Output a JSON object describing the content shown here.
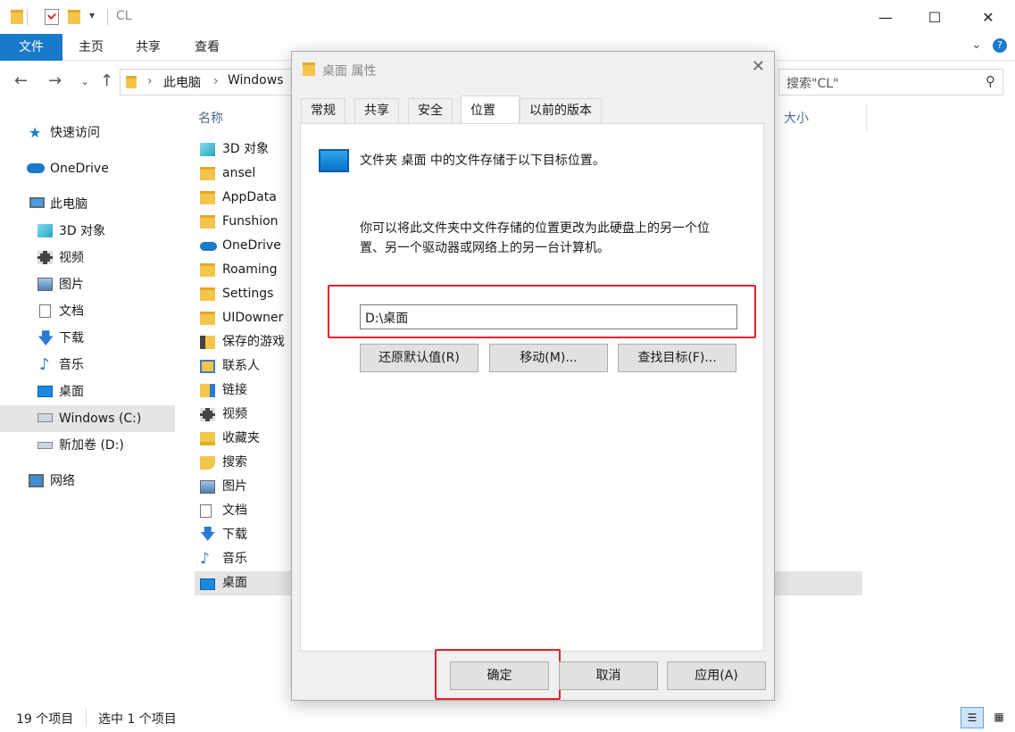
{
  "window": {
    "title": "CL",
    "ribbon_tabs": [
      "文件",
      "主页",
      "共享",
      "查看"
    ]
  },
  "address": {
    "crumbs": [
      "此电脑",
      "Windows"
    ],
    "search_placeholder": "搜索\"CL\""
  },
  "sidebar": {
    "items": [
      {
        "label": "快速访问",
        "icon": "star-icon"
      },
      {
        "label": "OneDrive",
        "icon": "cloud-icon"
      },
      {
        "label": "此电脑",
        "icon": "computer-icon"
      },
      {
        "label": "3D 对象",
        "icon": "cube-icon"
      },
      {
        "label": "视频",
        "icon": "video-icon"
      },
      {
        "label": "图片",
        "icon": "picture-icon"
      },
      {
        "label": "文档",
        "icon": "document-icon"
      },
      {
        "label": "下载",
        "icon": "download-icon"
      },
      {
        "label": "音乐",
        "icon": "music-icon"
      },
      {
        "label": "桌面",
        "icon": "desktop-icon"
      },
      {
        "label": "Windows (C:)",
        "icon": "drive-icon",
        "selected": true
      },
      {
        "label": "新加卷 (D:)",
        "icon": "drive-icon"
      },
      {
        "label": "网络",
        "icon": "network-icon"
      }
    ]
  },
  "filelist": {
    "col_name": "名称",
    "col_size": "大小",
    "rows": [
      {
        "label": "3D 对象",
        "icon": "cube-icon"
      },
      {
        "label": "ansel",
        "icon": "folder-icon"
      },
      {
        "label": "AppData",
        "icon": "folder-icon"
      },
      {
        "label": "Funshion",
        "icon": "folder-icon"
      },
      {
        "label": "OneDrive",
        "icon": "cloud-icon"
      },
      {
        "label": "Roaming",
        "icon": "folder-icon"
      },
      {
        "label": "Settings",
        "icon": "folder-icon"
      },
      {
        "label": "UIDowner",
        "icon": "folder-icon"
      },
      {
        "label": "保存的游戏",
        "icon": "game-icon"
      },
      {
        "label": "联系人",
        "icon": "contacts-icon"
      },
      {
        "label": "链接",
        "icon": "link-icon"
      },
      {
        "label": "视频",
        "icon": "video-icon"
      },
      {
        "label": "收藏夹",
        "icon": "favorites-icon"
      },
      {
        "label": "搜索",
        "icon": "search-folder-icon"
      },
      {
        "label": "图片",
        "icon": "picture-icon"
      },
      {
        "label": "文档",
        "icon": "document-icon"
      },
      {
        "label": "下载",
        "icon": "download-icon"
      },
      {
        "label": "音乐",
        "icon": "music-icon"
      },
      {
        "label": "桌面",
        "icon": "desktop-icon",
        "selected": true
      }
    ]
  },
  "status": {
    "count": "19 个项目",
    "selected": "选中 1 个项目"
  },
  "dialog": {
    "title": "桌面 属性",
    "tabs": [
      "常规",
      "共享",
      "安全",
      "位置",
      "以前的版本"
    ],
    "active_tab": "位置",
    "heading": "文件夹 桌面 中的文件存储于以下目标位置。",
    "description_line1": "你可以将此文件夹中文件存储的位置更改为此硬盘上的另一个位",
    "description_line2": "置、另一个驱动器或网络上的另一台计算机。",
    "path_value": "D:\\桌面",
    "restore_button": "还原默认值(R)",
    "move_button": "移动(M)...",
    "find_button": "查找目标(F)...",
    "ok_button": "确定",
    "cancel_button": "取消",
    "apply_button": "应用(A)"
  },
  "colors": {
    "accent": "#1979ca",
    "highlight": "#e8202a",
    "folder": "#f3c54a"
  }
}
